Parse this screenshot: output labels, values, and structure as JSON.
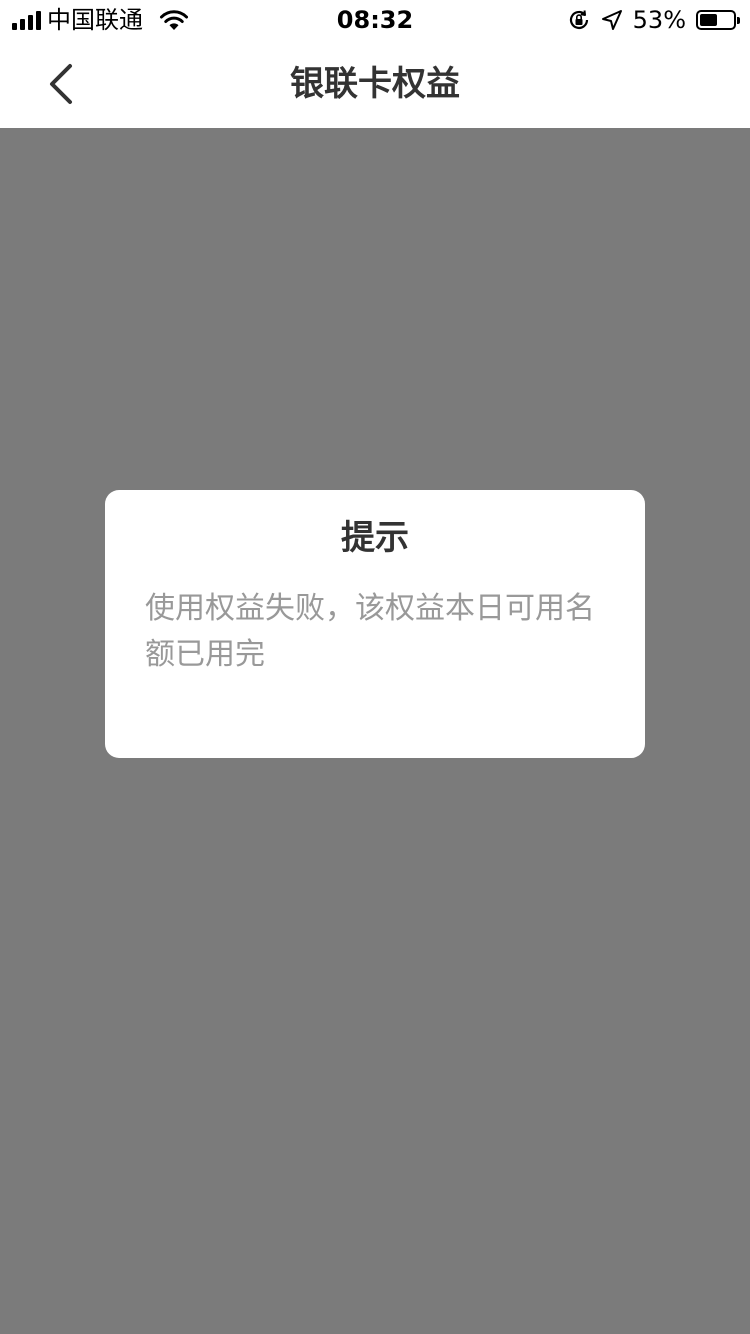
{
  "status_bar": {
    "carrier": "中国联通",
    "time": "08:32",
    "battery_percent": "53%",
    "battery_level": 0.53,
    "icons": [
      "signal-icon",
      "wifi-icon",
      "orientation-lock-icon",
      "location-icon",
      "battery-icon"
    ]
  },
  "nav": {
    "title": "银联卡权益",
    "back_icon": "chevron-left-icon"
  },
  "dialog": {
    "title": "提示",
    "message": "使用权益失败，该权益本日可用名额已用完"
  },
  "colors": {
    "overlay": "#7b7b7b",
    "surface": "#ffffff",
    "title_text": "#333333",
    "message_text": "#999999"
  }
}
